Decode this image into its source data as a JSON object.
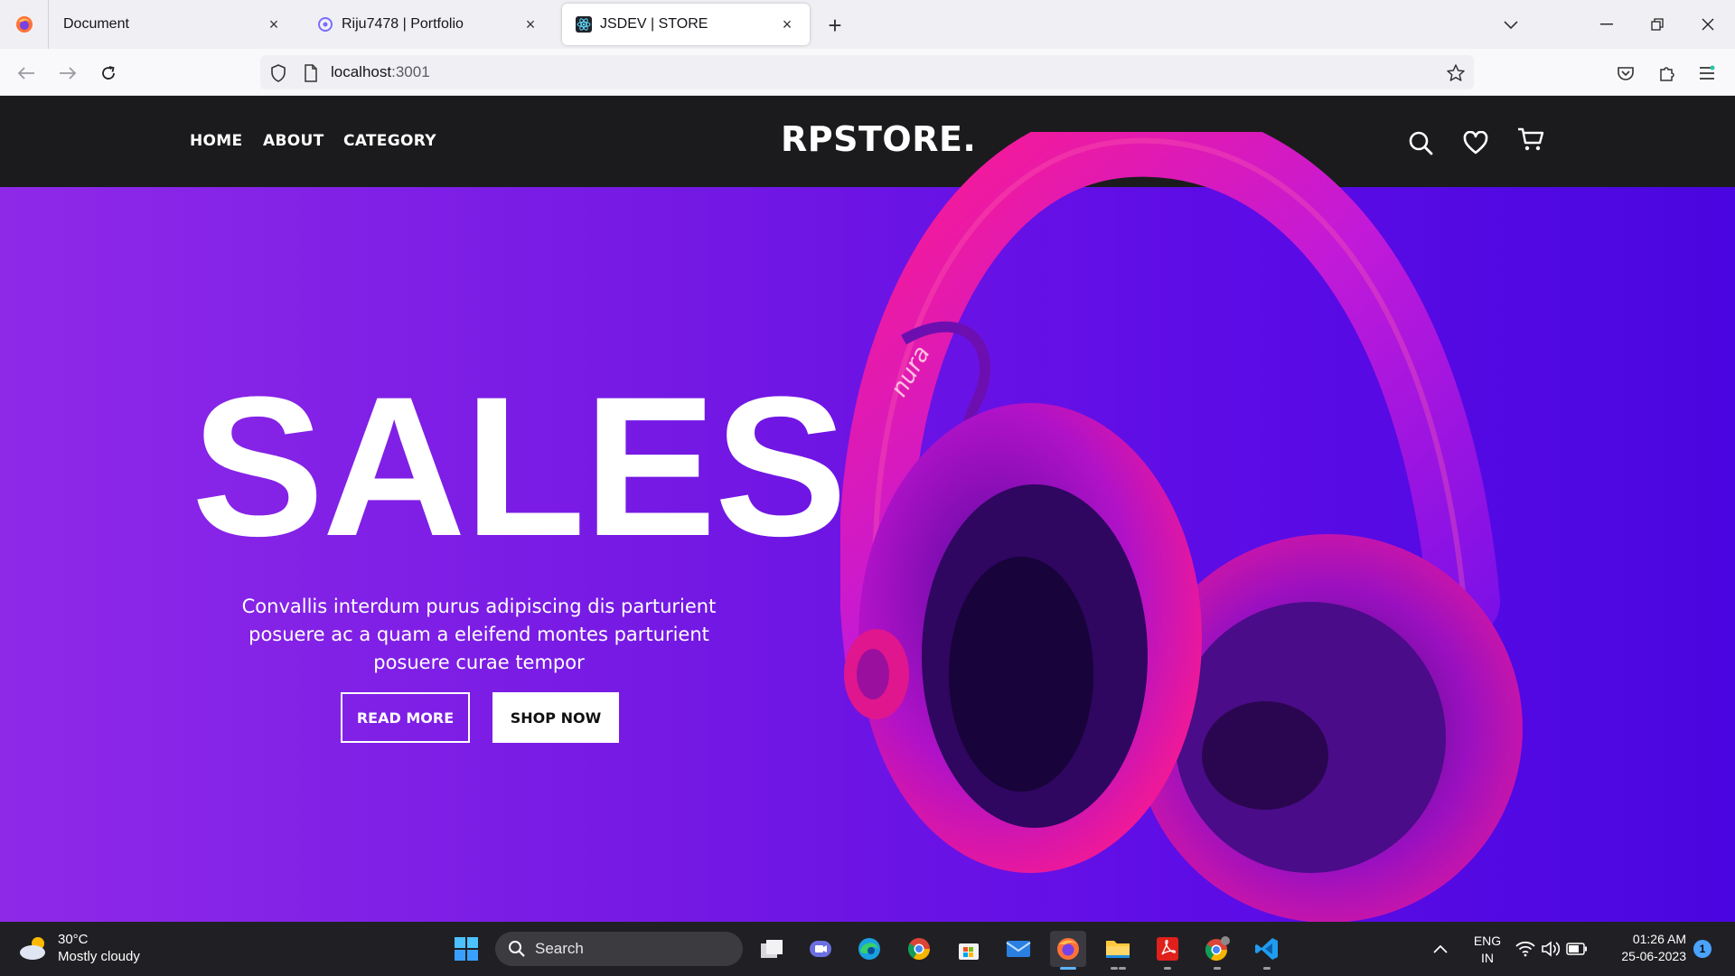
{
  "browser": {
    "tabs": [
      {
        "label": "Document",
        "icon": "firefox-icon"
      },
      {
        "label": "Riju7478 | Portfolio",
        "icon": "portfolio-icon"
      },
      {
        "label": "JSDEV | STORE",
        "icon": "react-icon"
      }
    ],
    "url_host": "localhost",
    "url_port": ":3001"
  },
  "site": {
    "nav": [
      "HOME",
      "ABOUT",
      "CATEGORY"
    ],
    "brand": "RPSTORE.",
    "header_icons": [
      "search-icon",
      "heart-icon",
      "cart-icon"
    ]
  },
  "hero": {
    "title": "SALES",
    "text": "Convallis interdum purus adipiscing dis parturient posuere ac a quam a eleifend montes parturient posuere curae tempor",
    "read_more": "READ MORE",
    "shop_now": "SHOP NOW",
    "product_mark": "nura"
  },
  "taskbar": {
    "weather_temp": "30°C",
    "weather_desc": "Mostly cloudy",
    "search_label": "Search",
    "lang_line1": "ENG",
    "lang_line2": "IN",
    "time": "01:26 AM",
    "date": "25-06-2023",
    "notification_count": "1"
  },
  "colors": {
    "hero_gradient_start": "#8f29e8",
    "hero_gradient_end": "#4a06e0",
    "header_bg": "#1b1b1d",
    "headphone_pink": "#ff1493",
    "taskbar_bg": "#202024"
  }
}
